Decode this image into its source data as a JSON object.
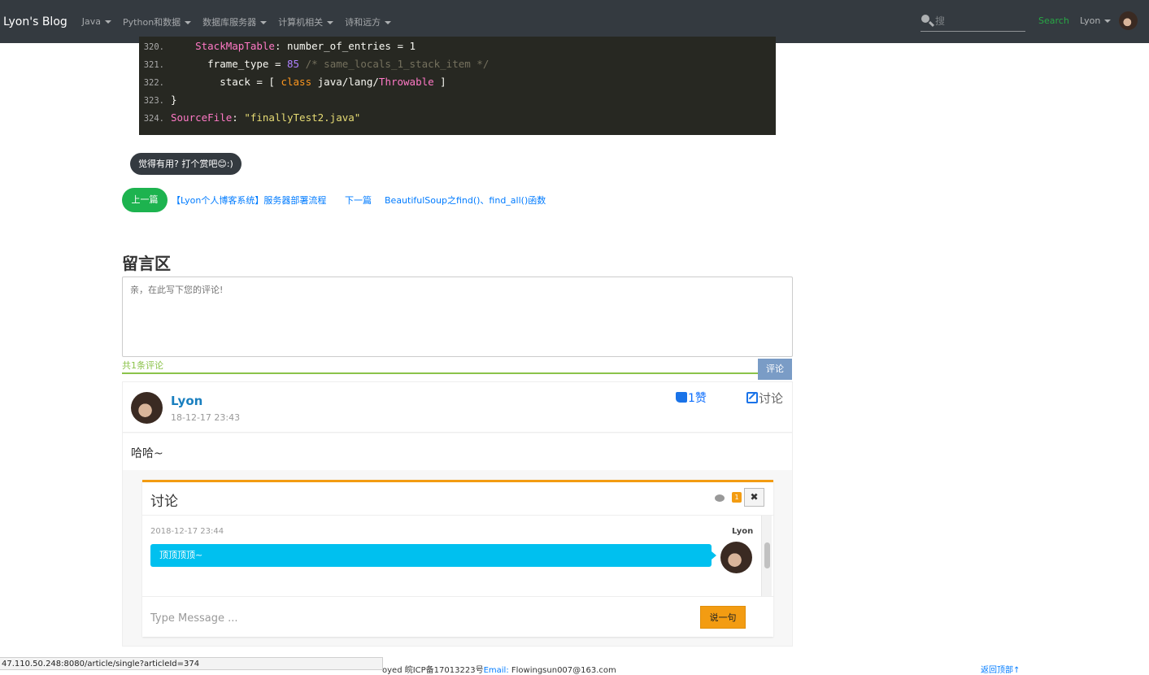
{
  "navbar": {
    "brand": "Lyon's Blog",
    "items": [
      {
        "label": "Java"
      },
      {
        "label": "Python和数据"
      },
      {
        "label": "数据库服务器"
      },
      {
        "label": "计算机相关"
      },
      {
        "label": "诗和远方"
      }
    ],
    "search_placeholder": "搜",
    "search_label": "Search",
    "user_label": "Lyon"
  },
  "code": {
    "lines": [
      {
        "num": "320.",
        "indent": "    ",
        "parts": [
          {
            "t": "StackMapTable",
            "c": "ty"
          },
          {
            "t": ": number_of_entries = 1",
            "c": ""
          }
        ]
      },
      {
        "num": "321.",
        "indent": "      ",
        "parts": [
          {
            "t": "frame_type = ",
            "c": ""
          },
          {
            "t": "85",
            "c": "num"
          },
          {
            "t": " /* same_locals_1_stack_item */",
            "c": "cm"
          }
        ]
      },
      {
        "num": "322.",
        "indent": "        ",
        "parts": [
          {
            "t": "stack = [ ",
            "c": ""
          },
          {
            "t": "class",
            "c": "kw"
          },
          {
            "t": " java/lang/",
            "c": ""
          },
          {
            "t": "Throwable",
            "c": "ty"
          },
          {
            "t": " ]",
            "c": ""
          }
        ]
      },
      {
        "num": "323.",
        "indent": "",
        "parts": [
          {
            "t": "}",
            "c": ""
          }
        ]
      },
      {
        "num": "324.",
        "indent": "",
        "parts": [
          {
            "t": "SourceFile",
            "c": "ty"
          },
          {
            "t": ": ",
            "c": ""
          },
          {
            "t": "\"finallyTest2.java\"",
            "c": "str"
          }
        ]
      }
    ]
  },
  "reward_label": "觉得有用? 打个赏吧😊:)",
  "pager": {
    "prev_label": "上一篇",
    "prev_title": "【Lyon个人博客系统】服务器部署流程",
    "next_label": "下一篇",
    "next_title": "BeautifulSoup之find()、find_all()函数"
  },
  "comments_section": {
    "title": "留言区",
    "placeholder": "亲，在此写下您的评论!",
    "count_text": "共1条评论",
    "submit_label": "评论"
  },
  "comment": {
    "author": "Lyon",
    "date": "18-12-17 23:43",
    "likes_text": "1赞",
    "discuss_label": "讨论",
    "body": "哈哈~"
  },
  "discussion": {
    "title": "讨论",
    "badge_count": "1",
    "close_label": "✖",
    "message": {
      "date": "2018-12-17 23:44",
      "author": "Lyon",
      "text": "顶顶顶顶~"
    },
    "input_placeholder": "Type Message ...",
    "send_label": "说一句"
  },
  "footer": {
    "text": "oyed 皖ICP备17013223号",
    "email_label": "Email:",
    "email": "Flowingsun007@163.com",
    "back_top": "返回顶部↑"
  },
  "status_bar_url": "47.110.50.248:8080/article/single?articleId=374",
  "colors": {
    "navbar": "#343a40",
    "accent_green": "#1db34f",
    "link_blue": "#007bff",
    "chat_orange": "#f39c12",
    "bubble_cyan": "#00c0ef"
  }
}
